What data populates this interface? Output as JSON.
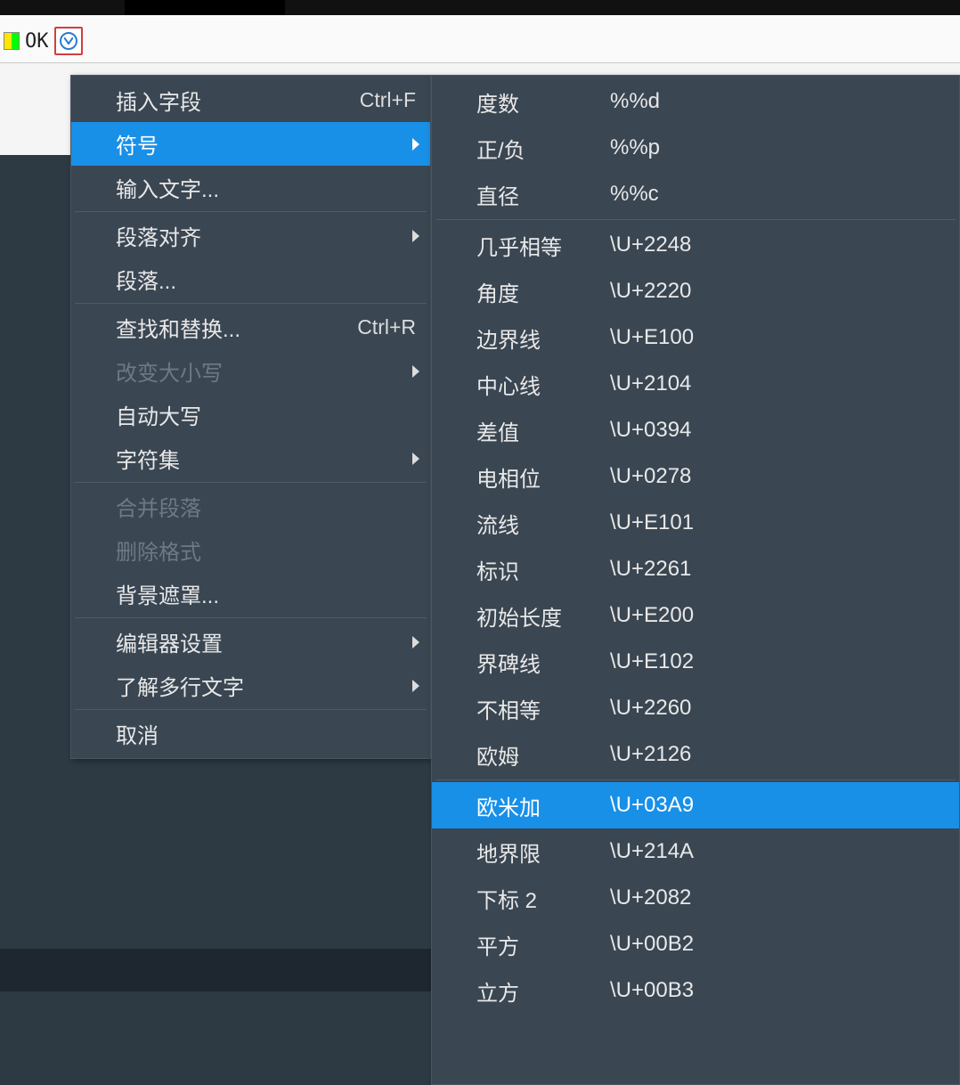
{
  "toolbar": {
    "ok_label": "OK"
  },
  "main_menu": [
    {
      "kind": "item",
      "label": "插入字段",
      "shortcut": "Ctrl+F"
    },
    {
      "kind": "item",
      "label": "符号",
      "submenu": true,
      "highlight": true
    },
    {
      "kind": "item",
      "label": "输入文字..."
    },
    {
      "kind": "sep"
    },
    {
      "kind": "item",
      "label": "段落对齐",
      "submenu": true
    },
    {
      "kind": "item",
      "label": "段落..."
    },
    {
      "kind": "sep"
    },
    {
      "kind": "item",
      "label": "查找和替换...",
      "shortcut": "Ctrl+R"
    },
    {
      "kind": "item",
      "label": "改变大小写",
      "submenu": true,
      "disabled": true
    },
    {
      "kind": "item",
      "label": "自动大写"
    },
    {
      "kind": "item",
      "label": "字符集",
      "submenu": true
    },
    {
      "kind": "sep"
    },
    {
      "kind": "item",
      "label": "合并段落",
      "disabled": true
    },
    {
      "kind": "item",
      "label": "删除格式",
      "disabled": true
    },
    {
      "kind": "item",
      "label": "背景遮罩..."
    },
    {
      "kind": "sep"
    },
    {
      "kind": "item",
      "label": "编辑器设置",
      "submenu": true
    },
    {
      "kind": "item",
      "label": "了解多行文字",
      "submenu": true
    },
    {
      "kind": "sep"
    },
    {
      "kind": "item",
      "label": "取消"
    }
  ],
  "sub_menu": [
    {
      "kind": "item",
      "name": "度数",
      "code": "%%d"
    },
    {
      "kind": "item",
      "name": "正/负",
      "code": "%%p"
    },
    {
      "kind": "item",
      "name": "直径",
      "code": "%%c"
    },
    {
      "kind": "sep"
    },
    {
      "kind": "item",
      "name": "几乎相等",
      "code": "\\U+2248"
    },
    {
      "kind": "item",
      "name": "角度",
      "code": "\\U+2220"
    },
    {
      "kind": "item",
      "name": "边界线",
      "code": "\\U+E100"
    },
    {
      "kind": "item",
      "name": "中心线",
      "code": "\\U+2104"
    },
    {
      "kind": "item",
      "name": "差值",
      "code": "\\U+0394"
    },
    {
      "kind": "item",
      "name": "电相位",
      "code": "\\U+0278"
    },
    {
      "kind": "item",
      "name": "流线",
      "code": "\\U+E101"
    },
    {
      "kind": "item",
      "name": "标识",
      "code": "\\U+2261"
    },
    {
      "kind": "item",
      "name": "初始长度",
      "code": "\\U+E200"
    },
    {
      "kind": "item",
      "name": "界碑线",
      "code": "\\U+E102"
    },
    {
      "kind": "item",
      "name": "不相等",
      "code": "\\U+2260"
    },
    {
      "kind": "item",
      "name": "欧姆",
      "code": "\\U+2126"
    },
    {
      "kind": "sep"
    },
    {
      "kind": "item",
      "name": "欧米加",
      "code": "\\U+03A9",
      "highlight": true
    },
    {
      "kind": "item",
      "name": "地界限",
      "code": "\\U+214A"
    },
    {
      "kind": "item",
      "name": "下标 2",
      "code": "\\U+2082"
    },
    {
      "kind": "item",
      "name": "平方",
      "code": "\\U+00B2"
    },
    {
      "kind": "item",
      "name": "立方",
      "code": "\\U+00B3"
    }
  ]
}
